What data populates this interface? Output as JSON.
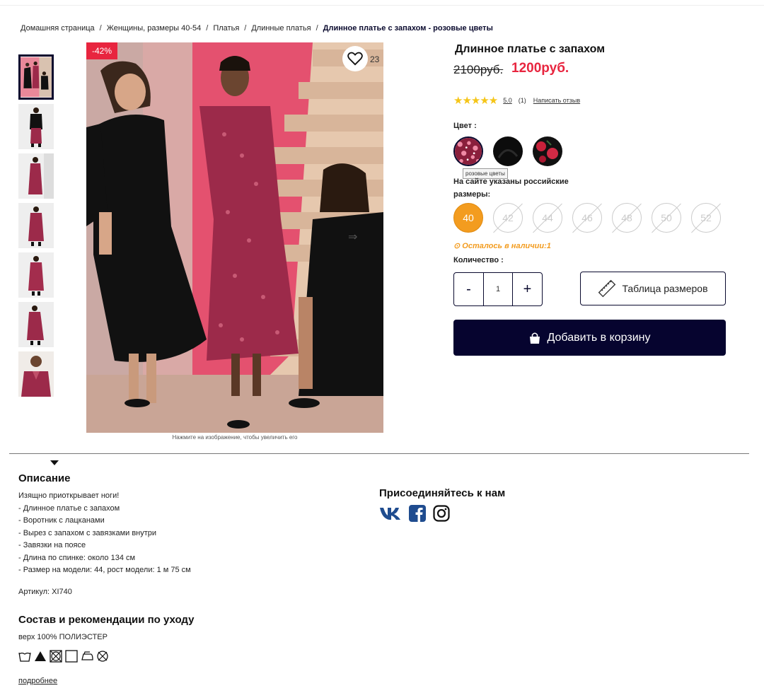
{
  "breadcrumb": {
    "items": [
      "Домашняя страница",
      "Женщины, размеры 40-54",
      "Платья",
      "Длинные платья"
    ],
    "current": "Длинное платье с запахом - розовые цветы",
    "separator": "/"
  },
  "gallery": {
    "discount_badge": "-42%",
    "favorites_count": "23",
    "zoom_hint": "Нажмите на изображение, чтобы увеличить его"
  },
  "product": {
    "title": "Длинное платье с запахом",
    "old_price": "2100руб.",
    "new_price": "1200руб.",
    "rating_stars": "★★★★★",
    "rating_value": "5.0",
    "rating_count": "(1)",
    "write_review": "Написать отзыв",
    "color_label": "Цвет :",
    "selected_color_tooltip": "розовые цветы",
    "size_note": "На сайте указаны российские размеры:",
    "sizes": [
      "40",
      "42",
      "44",
      "46",
      "48",
      "50",
      "52"
    ],
    "selected_size": "40",
    "stock_text": "Осталось в наличии:1",
    "qty_label": "Количество :",
    "qty_minus": "-",
    "qty_value": "1",
    "qty_plus": "+",
    "size_table_label": "Таблица размеров",
    "add_to_cart_label": "Добавить в корзину"
  },
  "description": {
    "title": "Описание",
    "lines": [
      "Изящно приоткрывает ноги!",
      "- Длинное платье с запахом",
      "- Воротник с лацканами",
      "- Вырез с запахом с завязками внутри",
      "- Завязки на поясе",
      "- Длина по спинке: около 134 см",
      "- Размер на модели: 44, рост модели: 1 м 75 см"
    ],
    "sku": "Артикул: XI740"
  },
  "composition": {
    "title": "Состав и рекомендации по уходу",
    "text": "верх 100% ПОЛИЭСТЕР",
    "more_link": "подробнее"
  },
  "social": {
    "title": "Присоединяйтесь к нам",
    "icons": [
      "vk-icon",
      "facebook-icon",
      "instagram-icon"
    ]
  },
  "colors": {
    "accent_red": "#e8253f",
    "selected_size_orange": "#f39c1f",
    "primary_navy": "#06042f",
    "social_blue": "#1f4c8f"
  }
}
